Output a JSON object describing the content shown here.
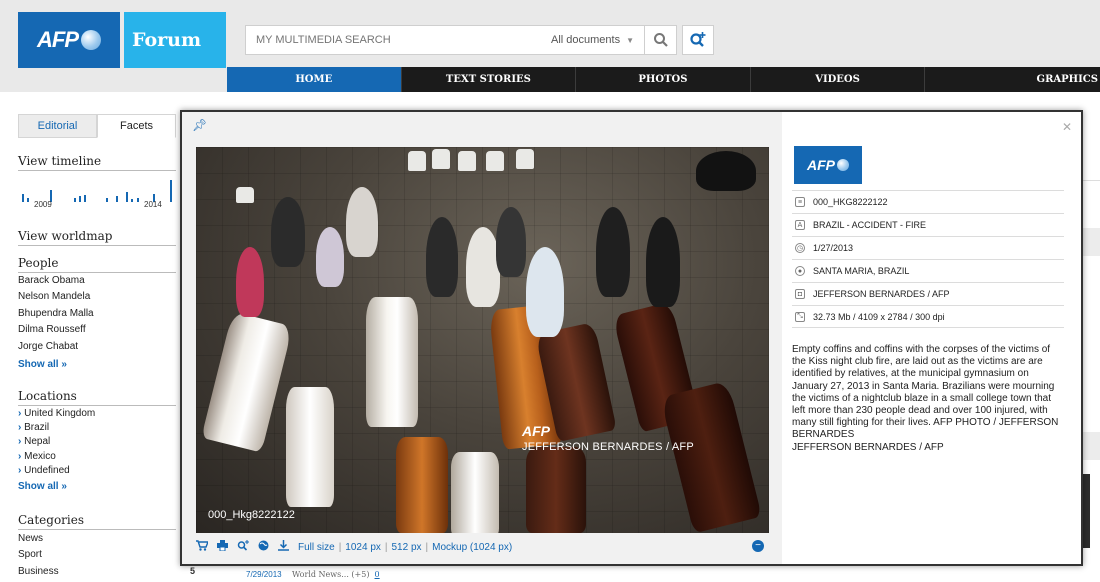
{
  "brand": {
    "logo_text": "AFP",
    "forum_label": "Forum"
  },
  "search": {
    "placeholder": "MY MULTIMEDIA SEARCH",
    "scope_label": "All documents",
    "search_icon": "magnifier-icon",
    "advanced_icon": "advanced-search-plus-icon"
  },
  "nav": {
    "tabs": [
      {
        "label": "HOME",
        "active": true
      },
      {
        "label": "TEXT STORIES"
      },
      {
        "label": "PHOTOS"
      },
      {
        "label": "VIDEOS"
      },
      {
        "label": "GRAPHICS"
      }
    ]
  },
  "sidebar": {
    "tabs": [
      "Editorial",
      "Facets"
    ],
    "timeline": {
      "heading": "View timeline",
      "start_label": "2009",
      "end_label": "2014"
    },
    "worldmap": {
      "heading": "View worldmap"
    },
    "people": {
      "heading": "People",
      "items": [
        "Barack Obama",
        "Nelson Mandela",
        "Bhupendra Malla",
        "Dilma Rousseff",
        "Jorge Chabat"
      ],
      "show_all": "Show all »"
    },
    "locations": {
      "heading": "Locations",
      "items": [
        "United Kingdom",
        "Brazil",
        "Nepal",
        "Mexico",
        "Undefined"
      ],
      "show_all": "Show all »"
    },
    "categories": {
      "heading": "Categories",
      "items": [
        "News",
        "Sport",
        "Business"
      ]
    }
  },
  "background": {
    "row_number": "5",
    "row_date": "7/29/2013",
    "row_category": "World News... (+5)",
    "row_count": "0"
  },
  "modal": {
    "photo_id": "000_Hkg8222122",
    "watermark_logo": "AFP",
    "watermark_credit": "JEFFERSON BERNARDES / AFP",
    "toolbar": {
      "icons": [
        "cart-icon",
        "print-icon",
        "search-similar-icon",
        "globe-icon",
        "download-icon"
      ],
      "sizes": [
        "Full size",
        "1024 px",
        "512 px",
        "Mockup (1024 px)"
      ]
    },
    "info": {
      "logo_text": "AFP",
      "meta": [
        {
          "icon": "document-id-icon",
          "value": "000_HKG8222122"
        },
        {
          "icon": "headline-icon",
          "value": "BRAZIL - ACCIDENT - FIRE"
        },
        {
          "icon": "clock-icon",
          "value": "1/27/2013"
        },
        {
          "icon": "location-globe-icon",
          "value": "SANTA MARIA, BRAZIL"
        },
        {
          "icon": "camera-icon",
          "value": "JEFFERSON BERNARDES / AFP"
        },
        {
          "icon": "resize-icon",
          "value": "32.73 Mb / 4109 x 2784 / 300 dpi"
        }
      ],
      "caption": "Empty coffins and coffins with the corpses of the victims of the Kiss night club fire, are laid out as the victims are are identified by relatives, at the municipal gymnasium on January 27, 2013 in Santa Maria. Brazilians were mourning the victims of a nightclub blaze in a small college town that left more than 230 people dead and over 100 injured, with many still fighting for their lives. AFP PHOTO / JEFFERSON BERNARDES",
      "credit_line": "JEFFERSON BERNARDES / AFP"
    }
  },
  "colors": {
    "afp_blue": "#1568b3",
    "forum_cyan": "#28b3ea",
    "nav_dark": "#1b1b1b",
    "header_grey": "#e9e9e9"
  }
}
